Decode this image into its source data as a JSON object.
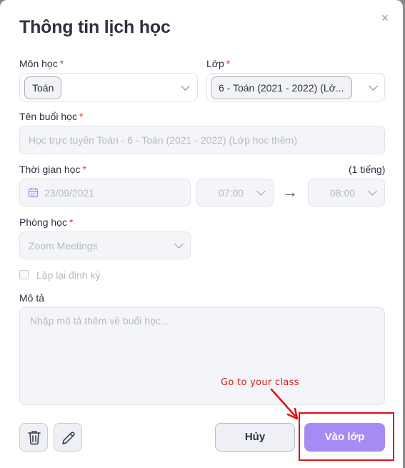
{
  "dialog": {
    "title": "Thông tin lịch học",
    "close_symbol": "×"
  },
  "fields": {
    "subject": {
      "label": "Môn học",
      "required_mark": "*",
      "value": "Toán"
    },
    "class": {
      "label": "Lớp",
      "required_mark": "*",
      "value": "6 - Toán (2021 - 2022) (Lớ..."
    },
    "session_name": {
      "label": "Tên buổi học",
      "required_mark": "*",
      "value": "Học trực tuyến Toán - 6 - Toán (2021 - 2022) (Lớp học thêm)"
    },
    "time": {
      "label": "Thời gian học",
      "required_mark": "*",
      "duration": "(1 tiếng)",
      "date": "23/09/2021",
      "start": "07:00",
      "end": "08:00",
      "arrow": "→"
    },
    "room": {
      "label": "Phòng học",
      "required_mark": "*",
      "value": "Zoom Meetings"
    },
    "repeat": {
      "label": "Lặp lại định kỳ",
      "checked": false
    },
    "description": {
      "label": "Mô tả",
      "placeholder": "Nhập mô tả thêm về buổi học..."
    }
  },
  "actions": {
    "delete_icon": "trash-icon",
    "edit_icon": "pencil-icon",
    "cancel_label": "Hủy",
    "join_label": "Vào lớp"
  },
  "annotation": {
    "text": "Go to your class",
    "color": "#d11b1b"
  },
  "colors": {
    "primary": "#a58cf5",
    "required": "#e53935"
  }
}
